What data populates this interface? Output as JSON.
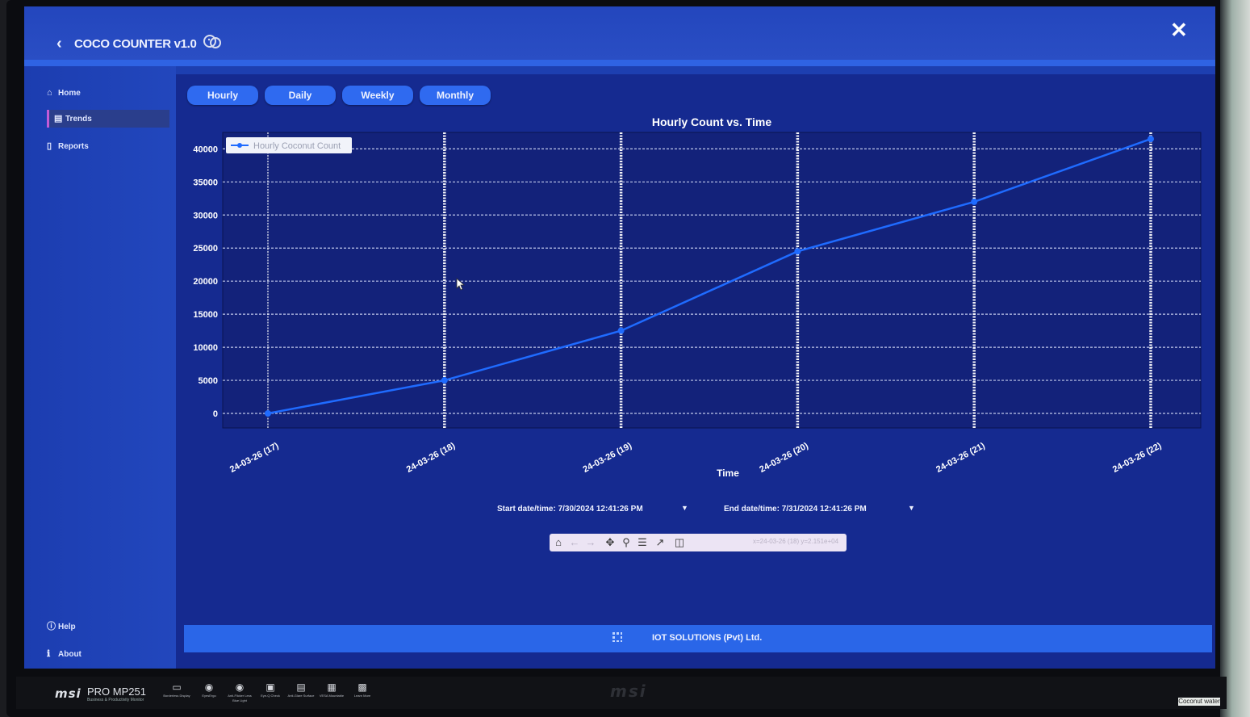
{
  "window": {
    "title": "COCO COUNTER v1.0",
    "colors": {
      "background": "#1d3fb0",
      "accent": "#2f6af0",
      "line": "#1f6bff"
    }
  },
  "sidebar": {
    "items": [
      {
        "label": "Home",
        "icon": "home-icon"
      },
      {
        "label": "Trends",
        "icon": "trends-icon"
      },
      {
        "label": "Reports",
        "icon": "reports-icon"
      }
    ],
    "bottom_items": [
      {
        "label": "Help",
        "icon": "help-icon"
      },
      {
        "label": "About",
        "icon": "about-icon"
      }
    ]
  },
  "tabs": [
    {
      "label": "Hourly"
    },
    {
      "label": "Daily"
    },
    {
      "label": "Weekly"
    },
    {
      "label": "Monthly"
    }
  ],
  "chart_data": {
    "type": "line",
    "title": "Hourly Count vs. Time",
    "xlabel": "Time",
    "ylabel": "",
    "ylim": [
      0,
      42000
    ],
    "yticks": [
      0,
      5000,
      10000,
      15000,
      20000,
      25000,
      30000,
      35000,
      40000
    ],
    "categories": [
      "24-03-26 (17)",
      "24-03-26 (18)",
      "24-03-26 (19)",
      "24-03-26 (20)",
      "24-03-26 (21)",
      "24-03-26 (22)"
    ],
    "series": [
      {
        "name": "Hourly Coconut Count",
        "values": [
          0,
          5000,
          12500,
          24500,
          32000,
          41500
        ]
      }
    ],
    "grid": true,
    "legend": "top-left"
  },
  "date_range": {
    "start_label": "Start date/time:",
    "start_value": "7/30/2024 12:41:26 PM",
    "end_label": "End date/time:",
    "end_value": "7/31/2024 12:41:26 PM"
  },
  "toolbar": {
    "buttons": [
      "home-icon",
      "back-arrow-icon",
      "forward-arrow-icon",
      "pan-icon",
      "zoom-icon",
      "configure-subplots-icon",
      "edit-axis-icon",
      "save-icon"
    ],
    "coords": "x=24-03-26 (18) y=2.151e+04"
  },
  "footer": {
    "text": "IOT SOLUTIONS (Pvt) Ltd."
  },
  "monitor": {
    "brand": "msi",
    "model": "PRO MP251",
    "model_sub": "Business & Productivity Monitor",
    "center_logo": "msi",
    "features": [
      "Borderless Display",
      "EyesErgo",
      "Anti-Flicker Less Blue Light",
      "Eye-Q Check",
      "Anti-Glare Surface",
      "VESA Mountable",
      "Learn More"
    ],
    "sticker": "Coconut water"
  }
}
